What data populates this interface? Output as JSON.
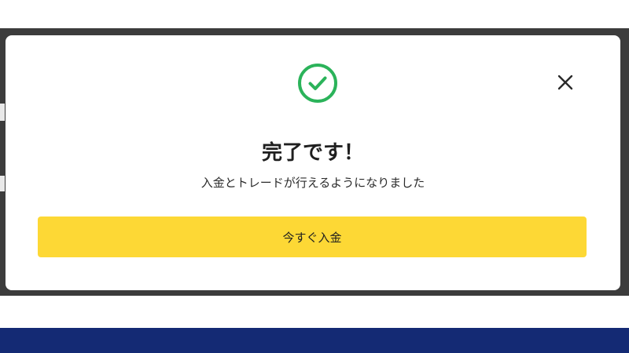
{
  "modal": {
    "title": "完了です！",
    "message": "入金とトレードが行えるようになりました",
    "deposit_button_label": "今すぐ入金",
    "success_icon": "check-circle-icon",
    "close_icon": "close-icon"
  },
  "colors": {
    "overlay": "#3c3c3c",
    "modal_background": "#ffffff",
    "success_green": "#2bb35a",
    "button_yellow": "#fdd835",
    "footer_navy": "#142a74",
    "text_dark": "#1f1f1f"
  }
}
